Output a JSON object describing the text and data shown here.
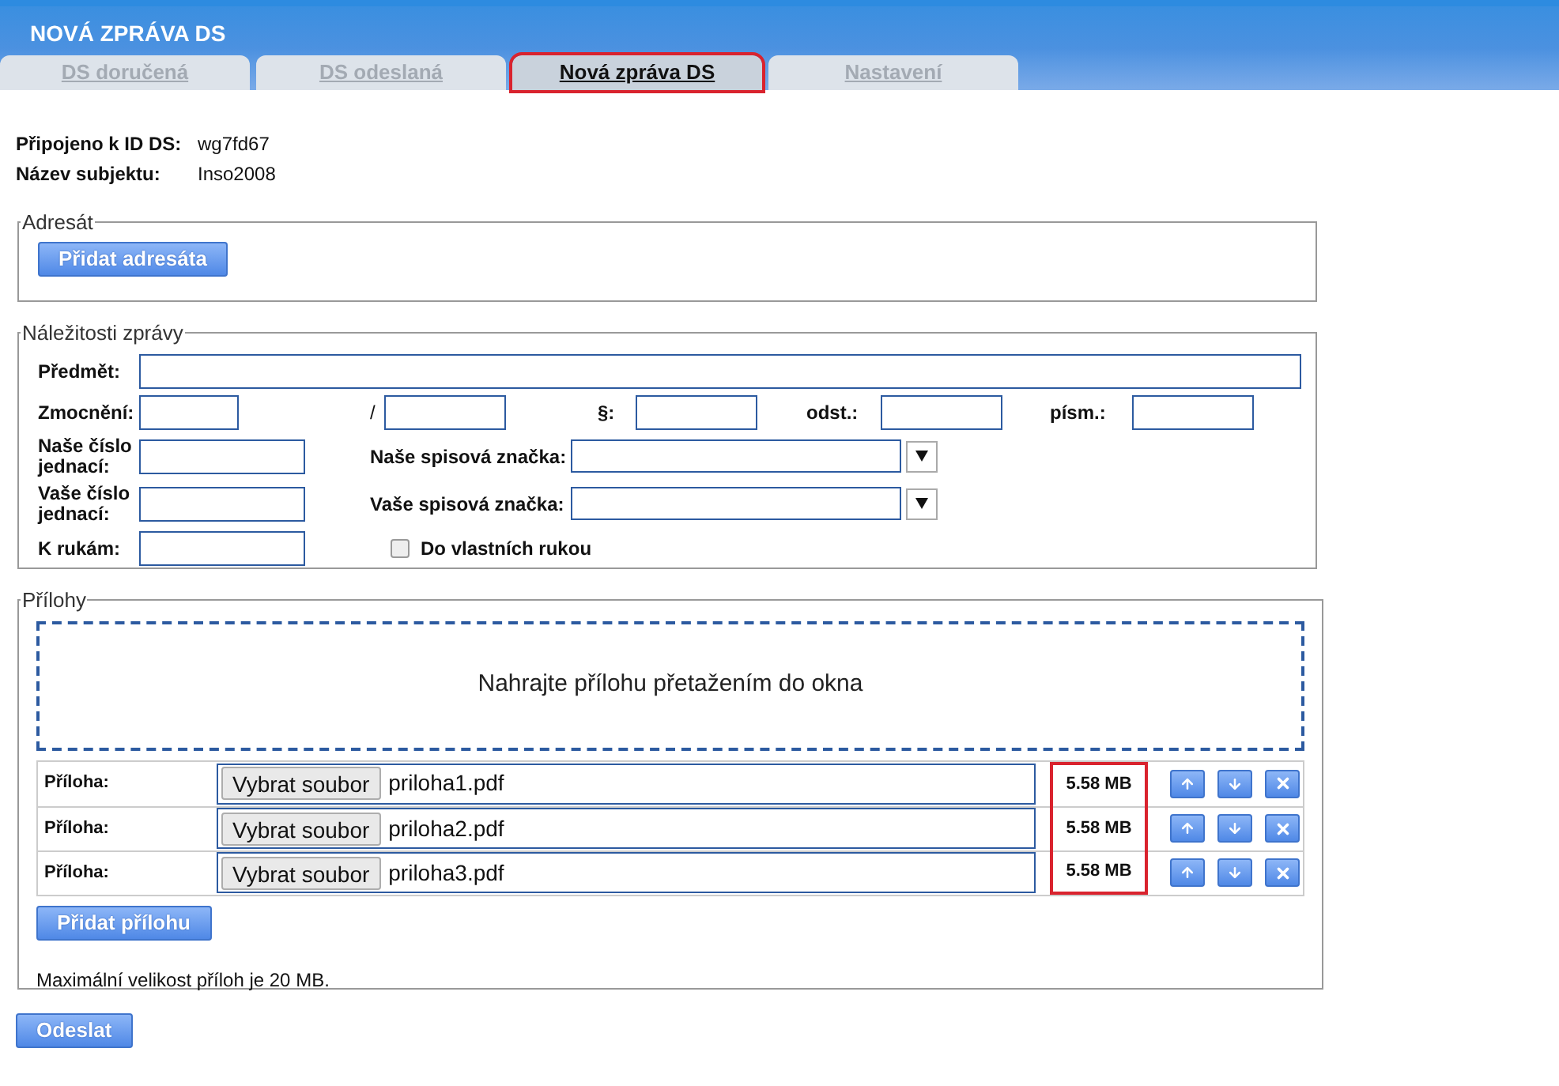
{
  "header": {
    "title": "NOVÁ ZPRÁVA DS"
  },
  "tabs": [
    {
      "label": "DS doručená",
      "selected": false,
      "highlighted": false
    },
    {
      "label": "DS odeslaná",
      "selected": false,
      "highlighted": false
    },
    {
      "label": "Nová zpráva DS",
      "selected": true,
      "highlighted": true
    },
    {
      "label": "Nastavení",
      "selected": false,
      "highlighted": false
    }
  ],
  "connection": [
    {
      "label": "Připojeno k ID DS:",
      "value": "wg7fd67"
    },
    {
      "label": "Název subjektu:",
      "value": "Inso2008"
    }
  ],
  "recipient": {
    "legend": "Adresát",
    "add_button": "Přidat adresáta"
  },
  "details": {
    "legend": "Náležitosti zprávy",
    "subject_label": "Předmět:",
    "authorization": {
      "label": "Zmocnění:",
      "separators": [
        "/",
        "§:",
        "odst.:",
        "písm.:"
      ]
    },
    "rows": [
      {
        "label": "Naše číslo jednací:",
        "reference_label": "Naše spisová značka:"
      },
      {
        "label": "Vaše číslo jednací:",
        "reference_label": "Vaše spisová značka:"
      }
    ],
    "hands_label": "K rukám:",
    "personal": {
      "label": "Do vlastních rukou",
      "checked": false
    }
  },
  "attachments": {
    "legend": "Přílohy",
    "dropzone": "Nahrajte přílohu přetažením do okna",
    "sizes_highlighted": true,
    "items": [
      {
        "label": "Příloha:",
        "choose_button": "Vybrat soubor",
        "file": "priloha1.pdf",
        "size": "5.58 MB"
      },
      {
        "label": "Příloha:",
        "choose_button": "Vybrat soubor",
        "file": "priloha2.pdf",
        "size": "5.58 MB"
      },
      {
        "label": "Příloha:",
        "choose_button": "Vybrat soubor",
        "file": "priloha3.pdf",
        "size": "5.58 MB"
      }
    ],
    "add_button": "Přidat přílohu",
    "note": "Maximální velikost příloh je 20 MB."
  },
  "send_button": "Odeslat"
}
